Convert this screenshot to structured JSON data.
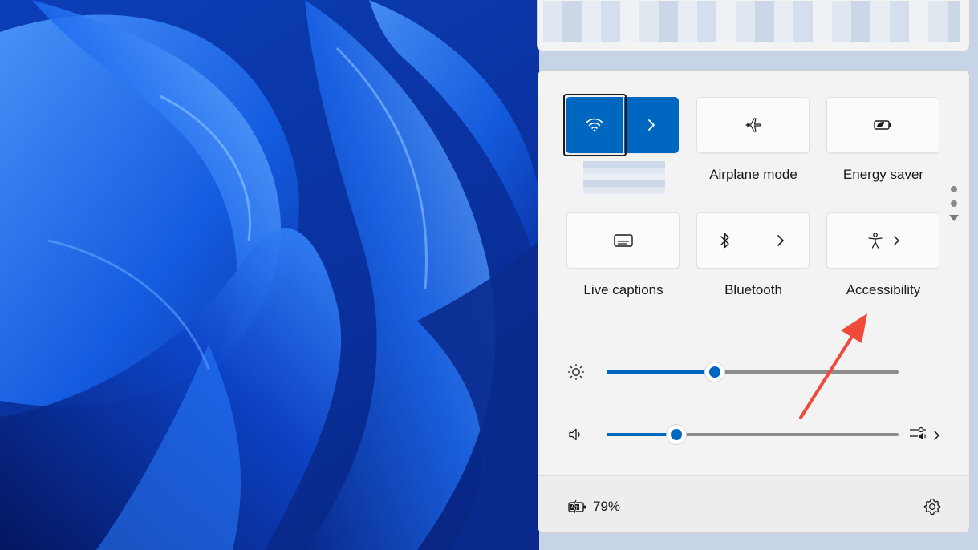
{
  "tiles": {
    "wifi": {
      "icon": "wifi-icon",
      "expand_icon": "chevron-right-icon"
    },
    "airplane": {
      "label": "Airplane mode",
      "icon": "airplane-icon"
    },
    "energy_saver": {
      "label": "Energy saver",
      "icon": "battery-leaf-icon"
    },
    "live_captions": {
      "label": "Live captions",
      "icon": "captions-icon"
    },
    "bluetooth": {
      "label": "Bluetooth",
      "icon": "bluetooth-icon",
      "expand_icon": "chevron-right-icon"
    },
    "accessibility": {
      "label": "Accessibility",
      "icon": "accessibility-icon",
      "expand_icon": "chevron-right-icon"
    }
  },
  "sliders": {
    "brightness": {
      "icon": "brightness-icon",
      "value_percent": 37
    },
    "volume": {
      "icon": "speaker-icon",
      "value_percent": 24,
      "output_icon": "audio-output-icon"
    }
  },
  "footer": {
    "battery_icon": "battery-charging-icon",
    "battery_text": "79%",
    "settings_icon": "gear-icon"
  },
  "colors": {
    "accent": "#0067c0",
    "annotation_arrow": "#f04a3a",
    "panel_bg": "#f3f3f3"
  }
}
